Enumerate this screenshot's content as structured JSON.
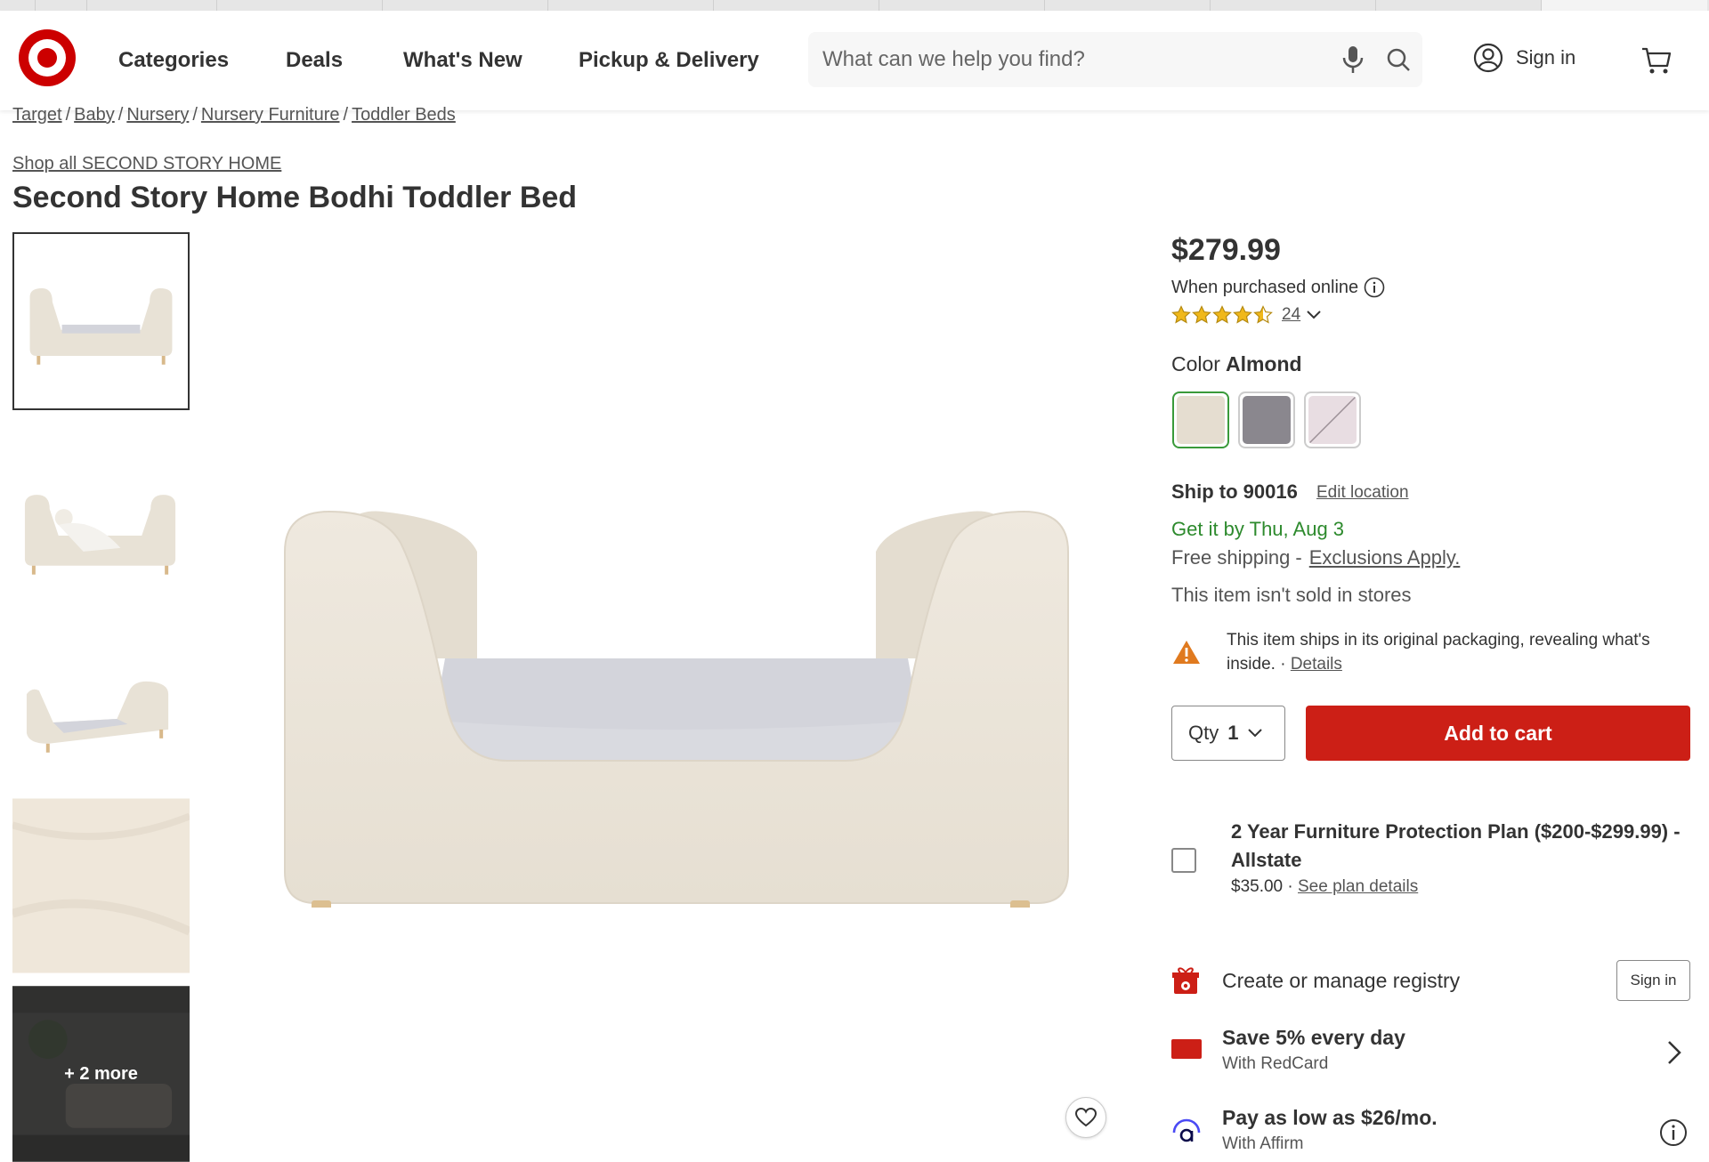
{
  "header": {
    "nav": [
      "Categories",
      "Deals",
      "What's New",
      "Pickup & Delivery"
    ],
    "search_placeholder": "What can we help you find?",
    "sign_in": "Sign in"
  },
  "breadcrumb": [
    "Target",
    "Baby",
    "Nursery",
    "Nursery Furniture",
    "Toddler Beds"
  ],
  "shop_all": "Shop all SECOND STORY HOME",
  "product": {
    "title": "Second Story Home Bodhi Toddler Bed",
    "price": "$279.99",
    "purchased_note": "When purchased online",
    "rating_value": 4.5,
    "rating_count": "24",
    "color_label": "Color",
    "color_selected": "Almond",
    "swatches": [
      {
        "name": "Almond",
        "hex": "#e5ddd0",
        "selected": true
      },
      {
        "name": "Gray",
        "hex": "#8a878e",
        "selected": false
      },
      {
        "name": "Blush",
        "hex": "#e8dde2",
        "selected": false
      }
    ]
  },
  "thumbnails": {
    "more_label": "+ 2 more"
  },
  "shipping": {
    "ship_to": "Ship to 90016",
    "edit_location": "Edit location",
    "get_it_by": "Get it by Thu, Aug 3",
    "free_shipping": "Free shipping -",
    "exclusions": "Exclusions Apply.",
    "not_in_stores": "This item isn't sold in stores",
    "packaging_warning": "This item ships in its original packaging, revealing what's inside. · ",
    "details_link": "Details"
  },
  "cart": {
    "qty_label": "Qty",
    "qty_value": "1",
    "add_to_cart": "Add to cart"
  },
  "protection_plan": {
    "title": "2 Year Furniture Protection Plan ($200-$299.99) - Allstate",
    "price": "$35.00 · ",
    "see_details": "See plan details"
  },
  "registry": {
    "text": "Create or manage registry",
    "button": "Sign in"
  },
  "redcard": {
    "title": "Save 5% every day",
    "subtitle": "With RedCard"
  },
  "affirm": {
    "title": "Pay as low as $26/mo.",
    "subtitle": "With Affirm"
  },
  "colors": {
    "target_red": "#cc0000",
    "add_to_cart_red": "#cc1f16",
    "delivery_green": "#2d8a2d",
    "warning_orange": "#e07a1f"
  }
}
